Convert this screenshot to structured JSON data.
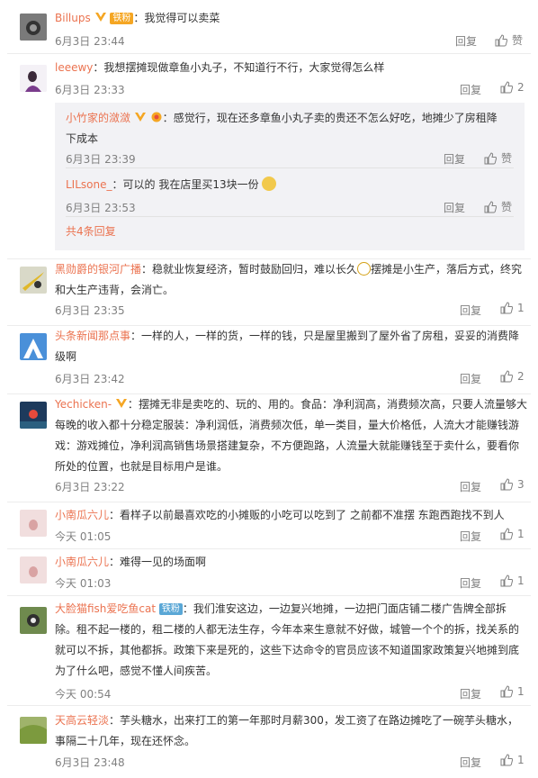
{
  "actions": {
    "reply": "回复",
    "like": "赞"
  },
  "comments": [
    {
      "user": "Billups",
      "sep": "：",
      "text": "我觉得可以卖菜",
      "time": "6月3日 23:44",
      "likes": "赞",
      "fans": "铁粉"
    },
    {
      "user": "leeewy",
      "sep": "：",
      "text": "我想摆摊现做章鱼小丸子，不知道行不行，大家觉得怎么样",
      "time": "6月3日 23:33",
      "likes": "2"
    },
    {
      "user": "黑勋爵的银河广播",
      "sep": "：",
      "text": "稳就业恢复经济，暂时鼓励回归，难以长久",
      "text2": "摆摊是小生产，落后方式，终究和大生产违背，会消亡。",
      "time": "6月3日 23:35",
      "likes": "1"
    },
    {
      "user": "头条新闻那点事",
      "sep": "：",
      "text": "一样的人，一样的货，一样的钱，只是屋里搬到了屋外省了房租，妥妥的消费降级啊",
      "time": "6月3日 23:42",
      "likes": "2"
    },
    {
      "user": "Yechicken-",
      "sep": "：",
      "text": "摆摊无非是卖吃的、玩的、用的。食品：净利润高，消费频次高，只要人流量够大每晚的收入都十分稳定服装：净利润低，消费频次低，单一类目，量大价格低，人流大才能赚钱游戏：游戏摊位，净利润高销售场景搭建复杂，不方便跑路，人流量大就能赚钱至于卖什么，要看你所处的位置，也就是目标用户是谁。",
      "time": "6月3日 23:22",
      "likes": "3"
    },
    {
      "user": "小南瓜六儿",
      "sep": "：",
      "text": "看样子以前最喜欢吃的小摊贩的小吃可以吃到了 之前都不准摆 东跑西跑找不到人",
      "time": "今天 01:05",
      "likes": "1"
    },
    {
      "user": "小南瓜六儿",
      "sep": "：",
      "text": "难得一见的场面啊",
      "time": "今天 01:03",
      "likes": "1"
    },
    {
      "user": "大脸猫fish爱吃鱼cat",
      "sep": "：",
      "text": "我们淮安这边，一边复兴地摊，一边把门面店铺二楼广告牌全部拆除。租不起一楼的，租二楼的人都无法生存，今年本来生意就不好做，城管一个个的拆，找关系的就可以不拆，其他都拆。政策下来是死的，这些下达命令的官员应该不知道国家政策复兴地摊到底为了什么吧，感觉不懂人间疾苦。",
      "time": "今天 00:54",
      "likes": "1",
      "fans": "铁粉"
    },
    {
      "user": "天高云轻淡",
      "sep": "：",
      "text": "芋头糖水，出来打工的第一年那时月薪300，发工资了在路边摊吃了一碗芋头糖水，事隔二十几年，现在还怀念。",
      "time": "6月3日 23:48",
      "likes": "1"
    }
  ],
  "subreplies": [
    {
      "user": "小竹家的潋潋",
      "sep": "：",
      "text": "感觉行，现在还多章鱼小丸子卖的贵还不怎么好吃，地摊少了房租降下成本",
      "time": "6月3日 23:39",
      "likes": "赞"
    },
    {
      "user": "LILsone_",
      "sep": "：",
      "text": "可以的 我在店里买13块一份",
      "time": "6月3日 23:53",
      "likes": "赞"
    }
  ],
  "more_replies": "共4条回复",
  "colors": {
    "username": "#eb7350",
    "meta": "#808080",
    "subreply_bg": "#f2f2f5",
    "vip_badge": "#f5a623"
  }
}
